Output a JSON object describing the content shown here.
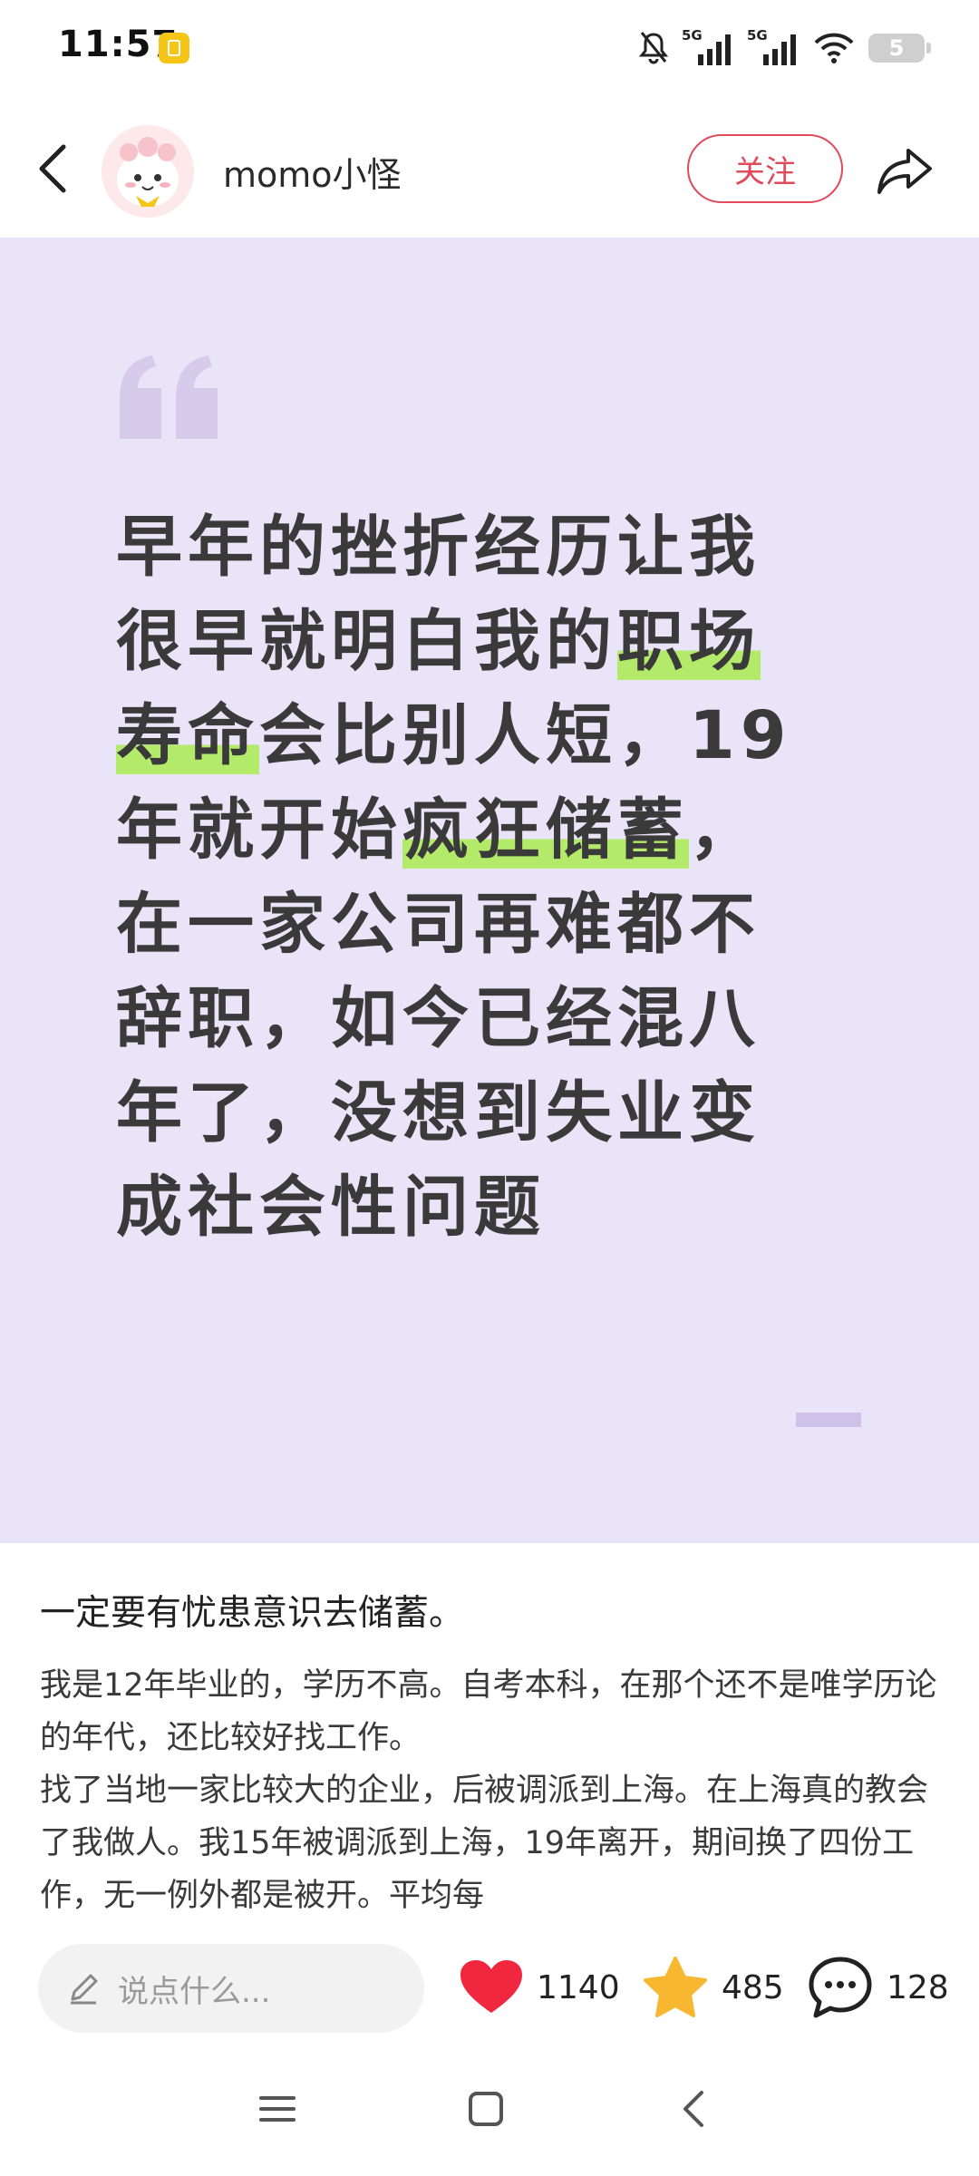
{
  "status_bar": {
    "time": "11:57",
    "network_1": "5G",
    "network_2": "5G",
    "battery_level": "5"
  },
  "header": {
    "username": "momo小怪",
    "follow_label": "关注"
  },
  "quote": {
    "parts": [
      {
        "text": "早年的挫折经历让我很早就明白我的",
        "highlight": false
      },
      {
        "text": "职场寿命",
        "highlight": true
      },
      {
        "text": "会比别人短，19年就开始",
        "highlight": false
      },
      {
        "text": "疯狂储蓄",
        "highlight": true
      },
      {
        "text": "，在一家公司再难都不辞职，如今已经混八年了，没想到失业变成社会性问题",
        "highlight": false
      }
    ],
    "highlight_color": "#b4ea6a",
    "card_color": "#e9e4f8"
  },
  "article": {
    "title": "一定要有忧患意识去储蓄。",
    "paragraphs": [
      "我是12年毕业的，学历不高。自考本科，在那个还不是唯学历论的年代，还比较好找工作。",
      "找了当地一家比较大的企业，后被调派到上海。在上海真的教会了我做人。我15年被调派到上海，19年离开，期间换了四份工作，无一例外都是被开。平均每"
    ]
  },
  "bottom_bar": {
    "comment_placeholder": "说点什么...",
    "likes": "1140",
    "favorites": "485",
    "comments": "128"
  },
  "colors": {
    "accent": "#e04a5a",
    "like_heart": "#f0273f",
    "favorite_star": "#f7b731"
  }
}
